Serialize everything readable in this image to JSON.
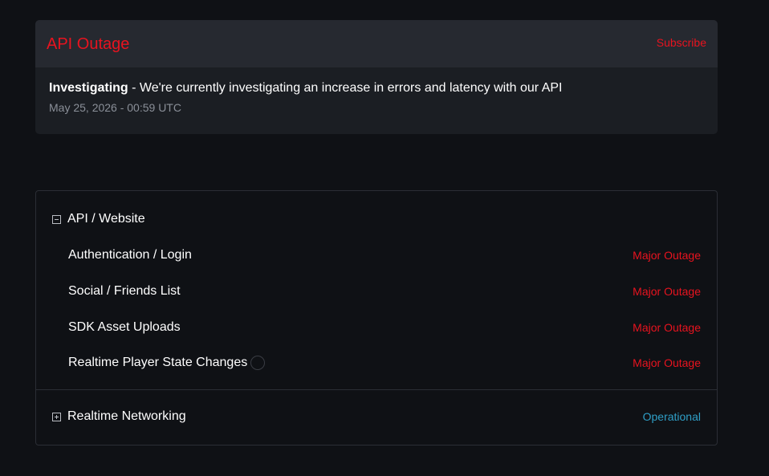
{
  "incident": {
    "title": "API Outage",
    "subscribe_label": "Subscribe",
    "update_status": "Investigating",
    "update_text": " - We're currently investigating an increase in errors and latency with our API",
    "timestamp": "May 25, 2026 - 00:59 UTC"
  },
  "components": {
    "group1": {
      "name": "API / Website",
      "items": [
        {
          "name": "Authentication / Login",
          "status": "Major Outage"
        },
        {
          "name": "Social / Friends List",
          "status": "Major Outage"
        },
        {
          "name": "SDK Asset Uploads",
          "status": "Major Outage"
        },
        {
          "name": "Realtime Player State Changes",
          "status": "Major Outage"
        }
      ]
    },
    "group2": {
      "name": "Realtime Networking",
      "status": "Operational"
    }
  },
  "colors": {
    "major_outage": "#e8131f",
    "operational": "#2f9fc7",
    "background": "#0f1115"
  },
  "icons": {
    "collapse": "minus-square-icon",
    "expand": "plus-square-icon",
    "help": "help-circle-icon"
  }
}
